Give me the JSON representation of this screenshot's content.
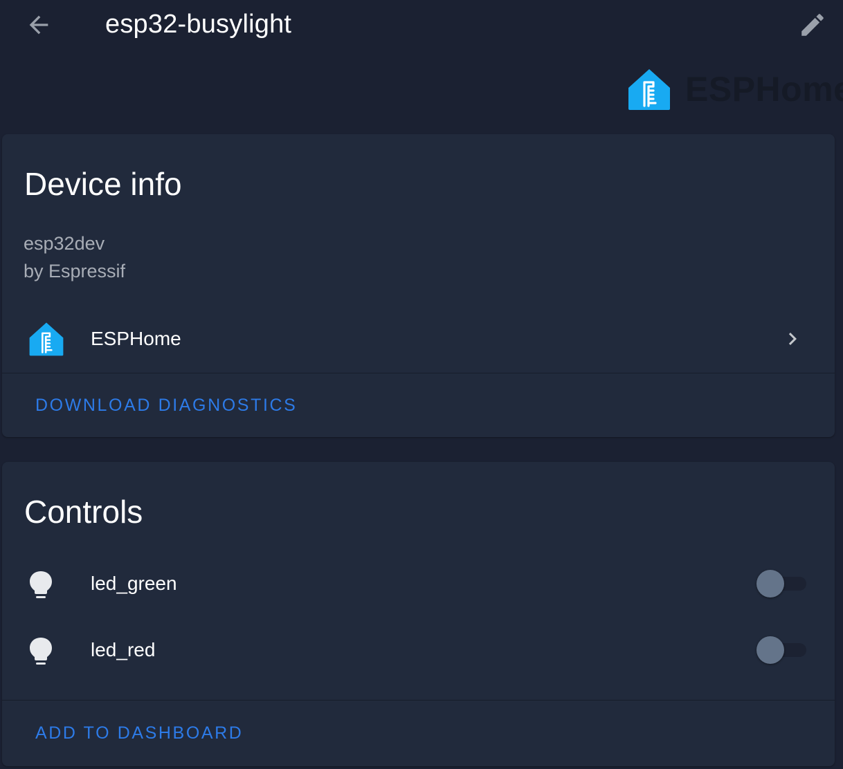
{
  "header": {
    "title": "esp32-busylight",
    "back_icon": "arrow-left-icon",
    "edit_icon": "pencil-icon"
  },
  "brand": {
    "name": "ESPHome",
    "logo_icon": "esphome-logo-icon",
    "logo_color": "#18aaf2"
  },
  "device_info": {
    "title": "Device info",
    "model": "esp32dev",
    "manufacturer": "by Espressif",
    "integration": {
      "label": "ESPHome",
      "icon": "esphome-logo-icon",
      "chevron": "chevron-right-icon"
    },
    "action_label": "DOWNLOAD DIAGNOSTICS"
  },
  "controls": {
    "title": "Controls",
    "entities": [
      {
        "label": "led_green",
        "icon": "lightbulb-icon",
        "state": "off"
      },
      {
        "label": "led_red",
        "icon": "lightbulb-icon",
        "state": "off"
      }
    ],
    "action_label": "ADD TO DASHBOARD"
  },
  "colors": {
    "background": "#1b2132",
    "card": "#212a3c",
    "accent": "#2d7be8",
    "toggle_knob_off": "#64748a"
  }
}
